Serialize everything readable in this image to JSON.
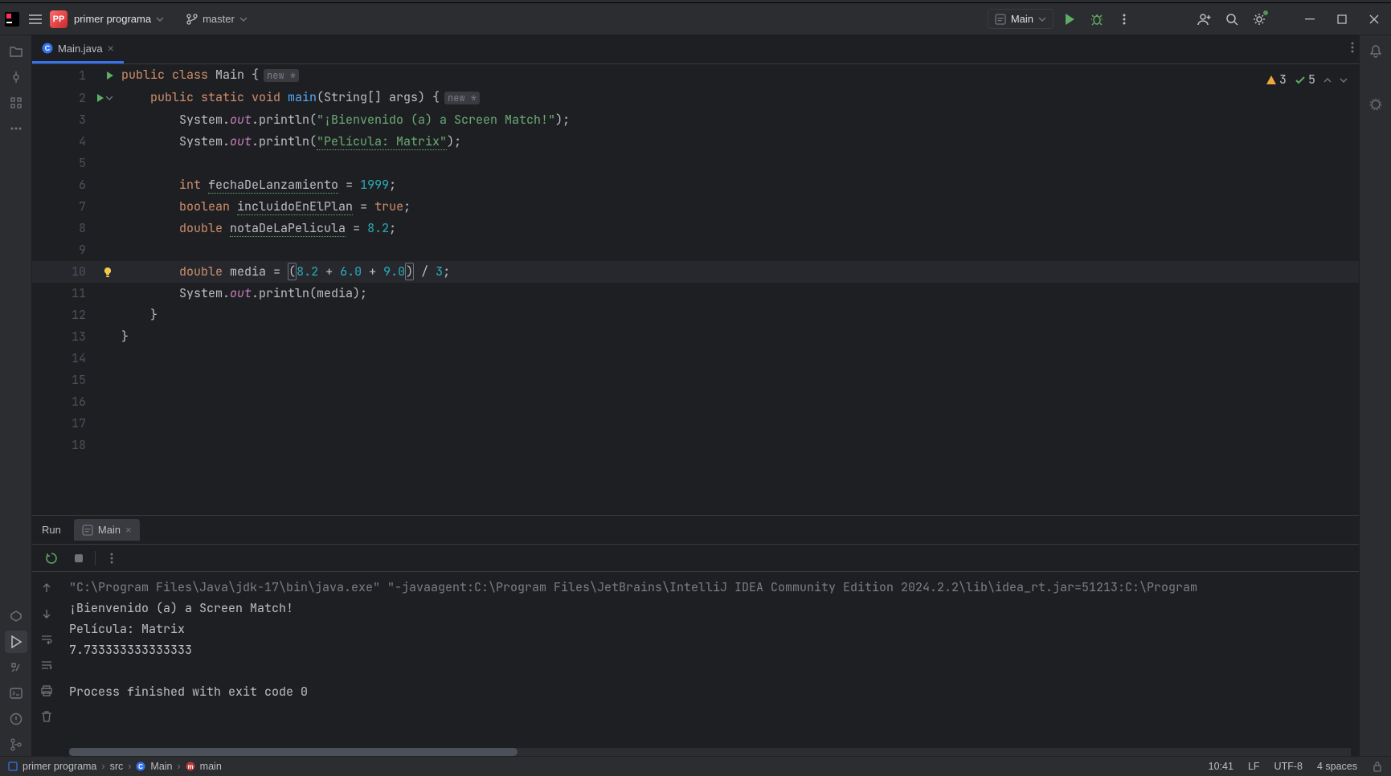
{
  "project": {
    "badge": "PP",
    "name": "primer programa",
    "branch": "master"
  },
  "runConfig": {
    "name": "Main"
  },
  "fileTab": {
    "name": "Main.java"
  },
  "inspections": {
    "warnings": "3",
    "checks": "5"
  },
  "code": {
    "hint_new1": "new *",
    "hint_new2": "new *",
    "line1_pre": "public class ",
    "line1_cls": "Main",
    "line1_post": " {",
    "line2_pre": "    public static void ",
    "line2_m": "main",
    "line2_args": "(String[] args) {",
    "line3_a": "        System.",
    "line3_out": "out",
    "line3_b": ".println(",
    "line3_str": "\"¡Bienvenido (a) a Screen Match!\"",
    "line3_c": ");",
    "line4_a": "        System.",
    "line4_out": "out",
    "line4_b": ".println(",
    "line4_str": "\"Película: Matrix\"",
    "line4_c": ");",
    "line6_a": "        ",
    "line6_kw": "int",
    "line6_b": " ",
    "line6_var": "fechaDeLanzamiento",
    "line6_c": " = ",
    "line6_num": "1999",
    "line6_d": ";",
    "line7_a": "        ",
    "line7_kw": "boolean",
    "line7_b": " ",
    "line7_var": "incluidoEnElPlan",
    "line7_c": " = ",
    "line7_val": "true",
    "line7_d": ";",
    "line8_a": "        ",
    "line8_kw": "double",
    "line8_b": " ",
    "line8_var": "notaDeLaPelicula",
    "line8_c": " = ",
    "line8_num": "8.2",
    "line8_d": ";",
    "line10_a": "        ",
    "line10_kw": "double",
    "line10_b": " media = ",
    "line10_p1": "(",
    "line10_n1": "8.2",
    "line10_op1": " + ",
    "line10_n2": "6.0",
    "line10_op2": " + ",
    "line10_n3": "9.0",
    "line10_p2": ")",
    "line10_op3": " / ",
    "line10_n4": "3",
    "line10_d": ";",
    "line11_a": "        System.",
    "line11_out": "out",
    "line11_b": ".println(media);",
    "line12": "    }",
    "line13": "}"
  },
  "runPanel": {
    "title": "Run",
    "tab": "Main"
  },
  "console": {
    "cmd": "\"C:\\Program Files\\Java\\jdk-17\\bin\\java.exe\" \"-javaagent:C:\\Program Files\\JetBrains\\IntelliJ IDEA Community Edition 2024.2.2\\lib\\idea_rt.jar=51213:C:\\Program",
    "l1": "¡Bienvenido (a) a Screen Match!",
    "l2": "Película: Matrix",
    "l3": "7.733333333333333",
    "l4": "",
    "l5": "Process finished with exit code 0"
  },
  "breadcrumb": {
    "p1": "primer programa",
    "p2": "src",
    "p3": "Main",
    "p4": "main"
  },
  "status": {
    "time": "10:41",
    "sep": "LF",
    "enc": "UTF-8",
    "indent": "4 spaces"
  }
}
